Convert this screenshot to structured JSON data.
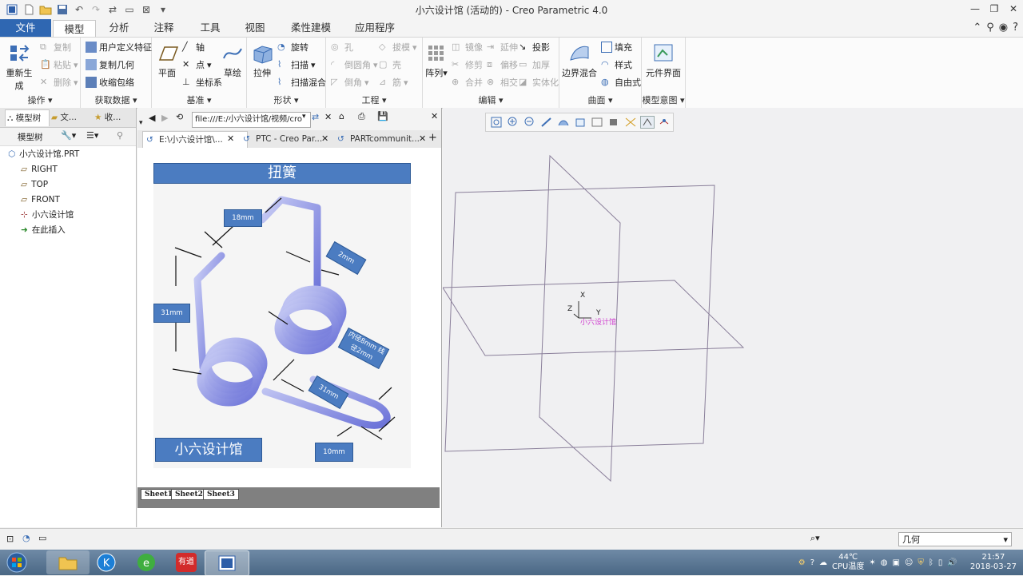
{
  "window": {
    "title": "小六设计馆 (活动的) - Creo Parametric 4.0"
  },
  "ribbon_tabs": [
    "文件",
    "模型",
    "分析",
    "注释",
    "工具",
    "视图",
    "柔性建模",
    "应用程序"
  ],
  "ribbon": {
    "operations": {
      "regenerate": "重新生成",
      "copy": "复制",
      "paste": "粘贴",
      "delete": "删除",
      "label": "操作"
    },
    "get_data": {
      "udf": "用户定义特征",
      "copy_geom": "复制几何",
      "shrinkwrap": "收缩包络",
      "label": "获取数据"
    },
    "datum": {
      "plane": "平面",
      "axis": "轴",
      "point": "点",
      "csys": "坐标系",
      "sketch": "草绘",
      "label": "基准"
    },
    "shapes": {
      "extrude": "拉伸",
      "revolve": "旋转",
      "sweep": "扫描",
      "swept_blend": "扫描混合",
      "label": "形状"
    },
    "engineering": {
      "hole": "孔",
      "draft": "拔模",
      "round": "倒圆角",
      "shell": "壳",
      "chamfer": "倒角",
      "rib": "筋",
      "label": "工程"
    },
    "editing": {
      "pattern": "阵列",
      "mirror": "镜像",
      "extend": "延伸",
      "project": "投影",
      "trim": "修剪",
      "offset": "偏移",
      "thicken": "加厚",
      "merge": "合并",
      "intersect": "相交",
      "solidify": "实体化",
      "label": "编辑"
    },
    "surfaces": {
      "boundary_blend": "边界混合",
      "fill": "填充",
      "style": "样式",
      "freestyle": "自由式",
      "label": "曲面"
    },
    "model_intent": {
      "component_interface": "元件界面",
      "label": "模型意图"
    }
  },
  "left_panel": {
    "tabs": [
      "模型树",
      "文...",
      "收..."
    ],
    "toolbar_label": "模型树",
    "tree": [
      {
        "label": "小六设计馆.PRT",
        "icon": "part-icon"
      },
      {
        "label": "RIGHT",
        "icon": "datum-plane-icon"
      },
      {
        "label": "TOP",
        "icon": "datum-plane-icon"
      },
      {
        "label": "FRONT",
        "icon": "datum-plane-icon"
      },
      {
        "label": "小六设计馆",
        "icon": "csys-icon"
      },
      {
        "label": "在此插入",
        "icon": "insert-arrow-icon"
      }
    ]
  },
  "browser": {
    "url": "file:///E:/小六设计馆/视频/cro",
    "tabs": [
      "E:\\小六设计馆\\...",
      "PTC - Creo Par...",
      "PARTcommunit..."
    ],
    "sheets": [
      "Sheet1",
      "Sheet2",
      "Sheet3"
    ],
    "image": {
      "title": "扭簧",
      "brand": "小六设计馆",
      "dims": [
        "18mm",
        "2mm",
        "31mm",
        "内径8mm 线径2mm",
        "31mm",
        "10mm"
      ]
    }
  },
  "viewport": {
    "csys": {
      "x": "X",
      "y": "Y",
      "z": "Z",
      "name": "小六设计馆"
    }
  },
  "status": {
    "filter": "几何"
  },
  "taskbar": {
    "temp": "44℃",
    "cpu_label": "CPU温度",
    "time": "21:57",
    "date": "2018-03-27",
    "youdao": "有道"
  }
}
